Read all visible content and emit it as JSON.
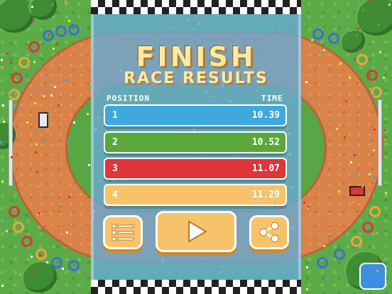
{
  "title": "FINISH",
  "subtitle": "RACE RESULTS",
  "headers": {
    "position": "POSITION",
    "time": "TIME"
  },
  "results": [
    {
      "pos": "1",
      "time": "10.39",
      "color": "#3fa9dd"
    },
    {
      "pos": "2",
      "time": "10.52",
      "color": "#5aa83a"
    },
    {
      "pos": "3",
      "time": "11.07",
      "color": "#e0353a"
    },
    {
      "pos": "4",
      "time": "11.29",
      "color": "#f7c36a"
    }
  ],
  "buttons": {
    "leaderboard_icon": "list-icon",
    "play_icon": "play-icon",
    "share_icon": "share-icon"
  },
  "colors": {
    "panel": "#68aad2",
    "title": "#fbe9a4",
    "button": "#f7c36a"
  }
}
